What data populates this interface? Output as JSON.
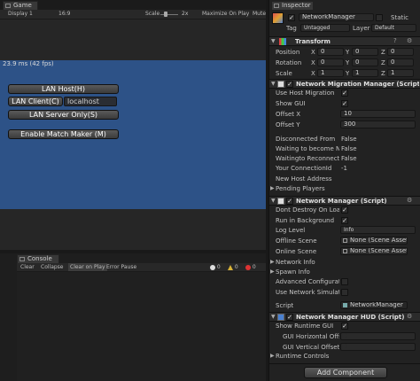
{
  "game": {
    "tab_label": "Game",
    "display": "Display 1",
    "aspect": "16:9",
    "scale_label": "Scale",
    "scale_value": "2x",
    "maximize_label": "Maximize On Play",
    "mute_label": "Mute",
    "fps_text": "23.9 ms (42 fps)",
    "lan_host": "LAN Host(H)",
    "lan_client": "LAN Client(C)",
    "lan_client_address": "localhost",
    "lan_server": "LAN Server Only(S)",
    "match_maker": "Enable Match Maker (M)",
    "viewport_color": "#2d5287"
  },
  "console": {
    "tab_label": "Console",
    "clear": "Clear",
    "collapse": "Collapse",
    "clear_on_play": "Clear on Play",
    "error_pause": "Error Pause",
    "log_count": "0",
    "warn_count": "0",
    "error_count": "0"
  },
  "inspector": {
    "tab_label": "Inspector",
    "object_name": "NetworkManager",
    "static_label": "Static",
    "tag_label": "Tag",
    "tag_value": "Untagged",
    "layer_label": "Layer",
    "layer_value": "Default",
    "transform": {
      "title": "Transform",
      "position_label": "Position",
      "rotation_label": "Rotation",
      "scale_label": "Scale",
      "x": "X",
      "y": "Y",
      "z": "Z",
      "position": [
        "0",
        "0",
        "0"
      ],
      "rotation": [
        "0",
        "0",
        "0"
      ],
      "scale": [
        "1",
        "1",
        "1"
      ]
    },
    "migration": {
      "title": "Network Migration Manager (Script)",
      "use_host_migration": "Use Host Migration",
      "show_gui": "Show GUI",
      "offset_x_label": "Offset X",
      "offset_x": "10",
      "offset_y_label": "Offset Y",
      "offset_y": "300",
      "disconnected_label": "Disconnected From H",
      "disconnected_value": "False",
      "waiting_new_label": "Waiting to become Ne",
      "waiting_new_value": "False",
      "waiting_reconnect_label": "Waitingto Reconnect t",
      "waiting_reconnect_value": "False",
      "connection_id_label": "Your ConnectionId",
      "connection_id_value": "-1",
      "new_host_label": "New Host Address",
      "pending_players": "Pending Players"
    },
    "manager": {
      "title": "Network Manager (Script)",
      "dont_destroy": "Dont Destroy On Loa",
      "run_background": "Run in Background",
      "log_level_label": "Log Level",
      "log_level_value": "Info",
      "offline_scene_label": "Offline Scene",
      "offline_scene_value": "None (Scene Asset)",
      "online_scene_label": "Online Scene",
      "online_scene_value": "None (Scene Asset)",
      "network_info": "Network Info",
      "spawn_info": "Spawn Info",
      "advanced_config": "Advanced Configurati",
      "use_simulator": "Use Network Simulato",
      "script_label": "Script",
      "script_value": "NetworkManager"
    },
    "hud": {
      "title": "Network Manager HUD (Script)",
      "show_runtime_gui": "Show Runtime GUI",
      "gui_h_offset": "GUI Horizontal Offs",
      "gui_h_value": "0",
      "gui_v_offset": "GUI Vertical Offset",
      "gui_v_value": "0",
      "runtime_controls": "Runtime Controls"
    },
    "add_component": "Add Component"
  }
}
